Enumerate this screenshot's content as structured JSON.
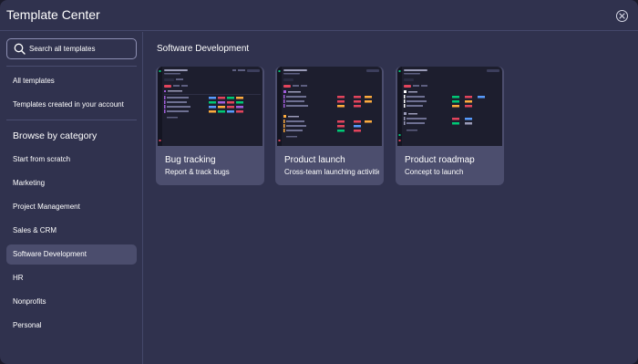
{
  "modal": {
    "title": "Template Center"
  },
  "sidebar": {
    "search_placeholder": "Search all templates",
    "links": [
      "All templates",
      "Templates created in your account"
    ],
    "browse_title": "Browse by category",
    "categories": [
      "Start from scratch",
      "Marketing",
      "Project Management",
      "Sales & CRM",
      "Software Development",
      "HR",
      "Nonprofits",
      "Personal"
    ],
    "active_category": "Software Development"
  },
  "main": {
    "section_title": "Software Development",
    "cards": [
      {
        "title": "Bug tracking",
        "desc": "Report & track bugs"
      },
      {
        "title": "Product launch",
        "desc": "Cross-team launching activities"
      },
      {
        "title": "Product roadmap",
        "desc": "Concept to launch"
      }
    ]
  },
  "colors": {
    "modal_bg": "#30324e",
    "card_bg": "#4c4e6e",
    "active_item_bg": "#4b4d6d",
    "thumbnail_bg": "#1d1e2e",
    "status_green": "#00c875",
    "status_red": "#e2445c",
    "status_orange": "#fdab3d",
    "status_purple": "#a25ddc",
    "status_blue": "#579bfc"
  }
}
